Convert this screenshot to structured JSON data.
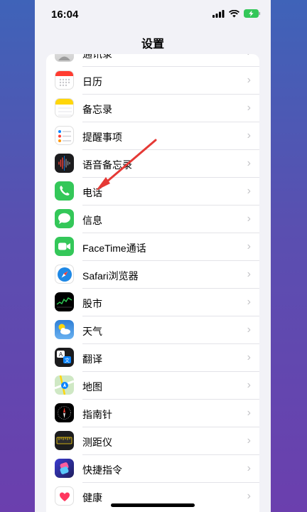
{
  "status": {
    "time": "16:04"
  },
  "nav": {
    "title": "设置"
  },
  "rows": [
    {
      "label": "通讯录",
      "icon": "contacts-icon"
    },
    {
      "label": "日历",
      "icon": "calendar-icon"
    },
    {
      "label": "备忘录",
      "icon": "notes-icon"
    },
    {
      "label": "提醒事项",
      "icon": "reminders-icon"
    },
    {
      "label": "语音备忘录",
      "icon": "voice-memos-icon"
    },
    {
      "label": "电话",
      "icon": "phone-icon"
    },
    {
      "label": "信息",
      "icon": "messages-icon"
    },
    {
      "label": "FaceTime通话",
      "icon": "facetime-icon"
    },
    {
      "label": "Safari浏览器",
      "icon": "safari-icon"
    },
    {
      "label": "股市",
      "icon": "stocks-icon"
    },
    {
      "label": "天气",
      "icon": "weather-icon"
    },
    {
      "label": "翻译",
      "icon": "translate-icon"
    },
    {
      "label": "地图",
      "icon": "maps-icon"
    },
    {
      "label": "指南针",
      "icon": "compass-icon"
    },
    {
      "label": "测距仪",
      "icon": "measure-icon"
    },
    {
      "label": "快捷指令",
      "icon": "shortcuts-icon"
    },
    {
      "label": "健康",
      "icon": "health-icon"
    }
  ],
  "annotation": {
    "color": "#e53935",
    "target": "电话"
  }
}
